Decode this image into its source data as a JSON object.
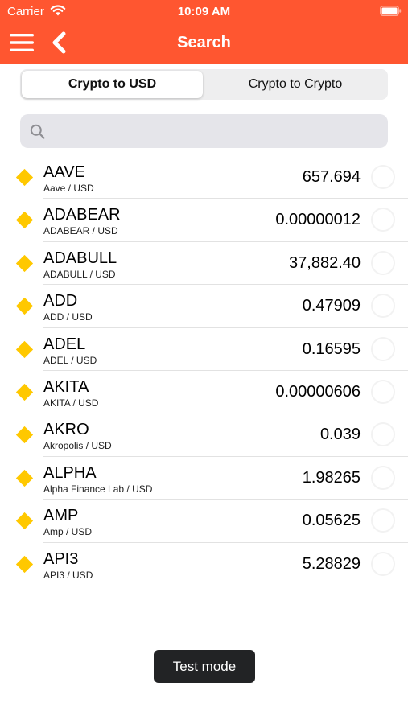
{
  "colors": {
    "accent": "#ff5630",
    "diamond": "#ffc800"
  },
  "status_bar": {
    "carrier": "Carrier",
    "time": "10:09 AM",
    "icons": [
      "wifi-icon",
      "battery-icon"
    ]
  },
  "nav": {
    "title": "Search",
    "icons": [
      "menu-icon",
      "back-icon"
    ]
  },
  "segments": [
    "Crypto to USD",
    "Crypto to Crypto"
  ],
  "selected_segment": "Crypto to USD",
  "search": {
    "placeholder": "",
    "value": ""
  },
  "rows": [
    {
      "symbol": "AAVE",
      "pair": "Aave / USD",
      "price": "657.694"
    },
    {
      "symbol": "ADABEAR",
      "pair": "ADABEAR / USD",
      "price": "0.00000012"
    },
    {
      "symbol": "ADABULL",
      "pair": "ADABULL / USD",
      "price": "37,882.40"
    },
    {
      "symbol": "ADD",
      "pair": "ADD / USD",
      "price": "0.47909"
    },
    {
      "symbol": "ADEL",
      "pair": "ADEL / USD",
      "price": "0.16595"
    },
    {
      "symbol": "AKITA",
      "pair": "AKITA / USD",
      "price": "0.00000606"
    },
    {
      "symbol": "AKRO",
      "pair": "Akropolis / USD",
      "price": "0.039"
    },
    {
      "symbol": "ALPHA",
      "pair": "Alpha Finance Lab / USD",
      "price": "1.98265"
    },
    {
      "symbol": "AMP",
      "pair": "Amp / USD",
      "price": "0.05625"
    },
    {
      "symbol": "API3",
      "pair": "API3 / USD",
      "price": "5.28829"
    }
  ],
  "toast": "Test mode"
}
